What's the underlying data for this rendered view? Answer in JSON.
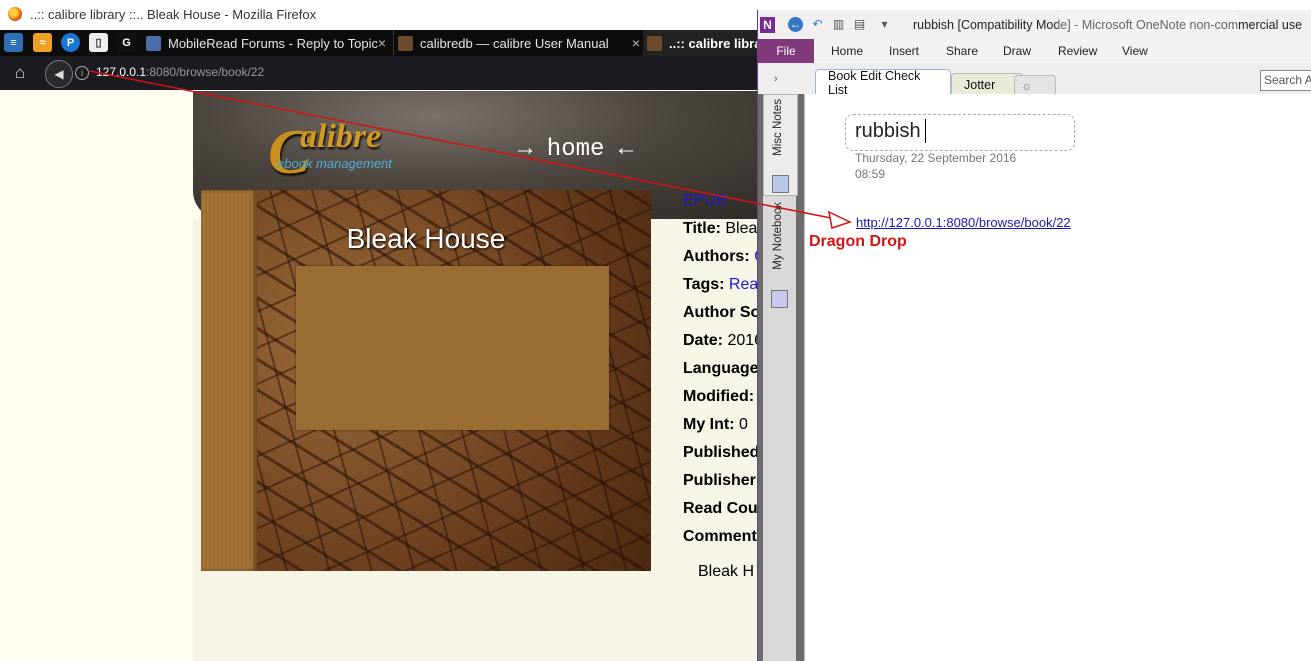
{
  "firefox": {
    "window_title": "..:: calibre library ::.. Bleak House - Mozilla Firefox",
    "tabs": [
      {
        "label": "MobileRead Forums - Reply to Topic",
        "close": "×"
      },
      {
        "label": "calibredb — calibre User Manual",
        "close": "×"
      },
      {
        "label": "..:: calibre library"
      }
    ],
    "pinned_icons": [
      "calibre-icon",
      "rss-icon",
      "p-icon",
      "paper-icon",
      "g-icon"
    ],
    "url_host": "127.0.0.1",
    "url_rest": ":8080/browse/book/22",
    "back_glyph": "◀",
    "home_glyph": "⌂"
  },
  "calibre": {
    "logo_c": "C",
    "logo_word": "alibre",
    "logo_sub": "ebook management",
    "home_link": "→ home ←",
    "cover_title": "Bleak House",
    "format": "EPUB",
    "fields": [
      {
        "label": "Title:",
        "value": " Blea",
        "link": false
      },
      {
        "label": "Authors:",
        "value": " C",
        "link": true
      },
      {
        "label": "Tags:",
        "value": " Rea",
        "link": true
      },
      {
        "label": "Author So",
        "value": "",
        "link": false
      },
      {
        "label": "Date:",
        "value": " 2016",
        "link": false
      },
      {
        "label": "Language",
        "value": "",
        "link": false
      },
      {
        "label": "Modified:",
        "value": "",
        "link": false
      },
      {
        "label": "My Int:",
        "value": " 0",
        "link": false
      },
      {
        "label": "Published",
        "value": "",
        "link": false
      },
      {
        "label": "Publisher",
        "value": "",
        "link": false
      },
      {
        "label": "Read Cou",
        "value": "",
        "link": false
      },
      {
        "label": "Comment",
        "value": "",
        "link": false
      }
    ],
    "footer_text": "Bleak H"
  },
  "onenote": {
    "window_title": "rubbish [Compatibility Mode] - Microsoft OneNote non-commercial use",
    "ribbon_tabs": [
      "File",
      "Home",
      "Insert",
      "Share",
      "Draw",
      "Review",
      "View"
    ],
    "section_tabs": [
      "Book Edit Check List",
      "Jotter",
      "☼"
    ],
    "search_placeholder": "Search All",
    "notebooks": [
      "Misc Notes",
      "My Notebook"
    ],
    "page_title": "rubbish",
    "page_date": "Thursday, 22 September  2016",
    "page_time": "08:59",
    "link_text": "http://127.0.0.1:8080/browse/book/22"
  },
  "annotation": {
    "label": "Dragon Drop",
    "color": "#d41414"
  }
}
